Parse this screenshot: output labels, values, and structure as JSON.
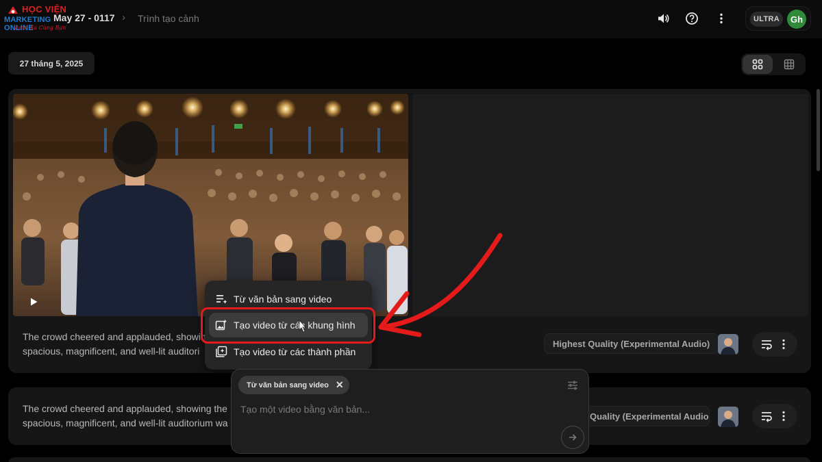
{
  "logo": {
    "line1": "HỌC VIỆN",
    "line2": "MARKETING ONLINE",
    "line3": "Vươn Xa Cùng Bạn"
  },
  "header": {
    "project_title": "May 27 - 0117",
    "separator": "›",
    "current_page": "Trình tạo cảnh",
    "plan_badge": "ULTRA",
    "avatar_initials": "Gh",
    "icons": [
      "volume-icon",
      "help-icon",
      "more-vert-icon"
    ]
  },
  "toolbar": {
    "date_label": "27 tháng 5, 2025",
    "view_modes": [
      "grid-large-icon",
      "grid-small-icon"
    ],
    "active_view": "grid-large"
  },
  "cards": [
    {
      "caption_line1": "The crowd cheered and applauded, showing",
      "caption_line2": "spacious, magnificent, and well-lit auditori",
      "quality": "Highest Quality (Experimental Audio)"
    },
    {
      "caption_line1": "The crowd cheered and applauded, showing the",
      "caption_line2": "spacious, magnificent, and well-lit auditorium wa",
      "quality": "Quality (Experimental Audio)"
    }
  ],
  "menu": {
    "items": [
      {
        "label": "Từ văn bản sang video",
        "icon": "text-lines-icon"
      },
      {
        "label": "Tạo video từ các khung hình",
        "icon": "image-sparkle-icon"
      },
      {
        "label": "Tạo video từ các thành phần",
        "icon": "layers-sparkle-icon"
      }
    ],
    "highlighted_index": 1
  },
  "composer": {
    "mode_chip": "Từ văn bản sang video",
    "placeholder": "Tạo một video bằng văn bản..."
  },
  "colors": {
    "background": "#000000",
    "card": "#161616",
    "menu": "#262626",
    "highlight": "#e51b1b",
    "avatar": "#2f8a3a"
  }
}
